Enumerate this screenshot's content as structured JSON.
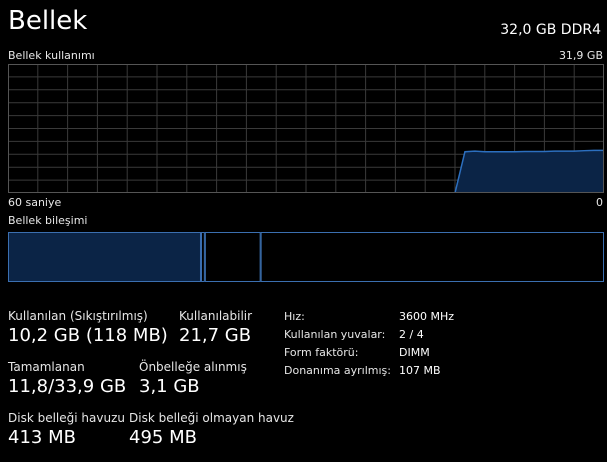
{
  "header": {
    "title": "Bellek",
    "spec": "32,0 GB DDR4"
  },
  "graph": {
    "label": "Bellek kullanımı",
    "max_label": "31,9 GB",
    "left_time": "60 saniye",
    "right_time": "0",
    "usage_fractions": [
      0,
      0,
      0,
      0,
      0,
      0,
      0,
      0,
      0,
      0,
      0,
      0,
      0,
      0,
      0,
      0,
      0,
      0,
      0,
      0,
      0,
      0,
      0,
      0,
      0,
      0,
      0,
      0,
      0,
      0,
      0,
      0,
      0,
      0,
      0,
      0,
      0,
      0,
      0,
      0,
      0,
      0,
      0,
      0,
      0,
      0,
      0.32,
      0.325,
      0.32,
      0.32,
      0.32,
      0.32,
      0.322,
      0.322,
      0.322,
      0.325,
      0.325,
      0.325,
      0.328,
      0.33,
      0.33
    ],
    "line_color": "#2c6fbf",
    "fill_color": "#0b2446",
    "grid_color": "#3a3a3a"
  },
  "composition": {
    "label": "Bellek bileşimi",
    "segment_fractions": [
      0.3238,
      0.0065,
      0.0936,
      0.5761
    ]
  },
  "stats": {
    "in_use": {
      "label": "Kullanılan (Sıkıştırılmış)",
      "value": "10,2 GB (118 MB)"
    },
    "available": {
      "label": "Kullanılabilir",
      "value": "21,7 GB"
    },
    "committed": {
      "label": "Tamamlanan",
      "value": "11,8/33,9 GB"
    },
    "cached": {
      "label": "Önbelleğe alınmış",
      "value": "3,1 GB"
    },
    "paged_pool": {
      "label": "Disk belleği havuzu",
      "value": "413 MB"
    },
    "nonpaged_pool": {
      "label": "Disk belleği olmayan havuz",
      "value": "495 MB"
    }
  },
  "properties": [
    {
      "key": "Hız:",
      "value": "3600 MHz"
    },
    {
      "key": "Kullanılan yuvalar:",
      "value": "2 / 4"
    },
    {
      "key": "Form faktörü:",
      "value": "DIMM"
    },
    {
      "key": "Donanıma ayrılmış:",
      "value": "107 MB"
    }
  ]
}
